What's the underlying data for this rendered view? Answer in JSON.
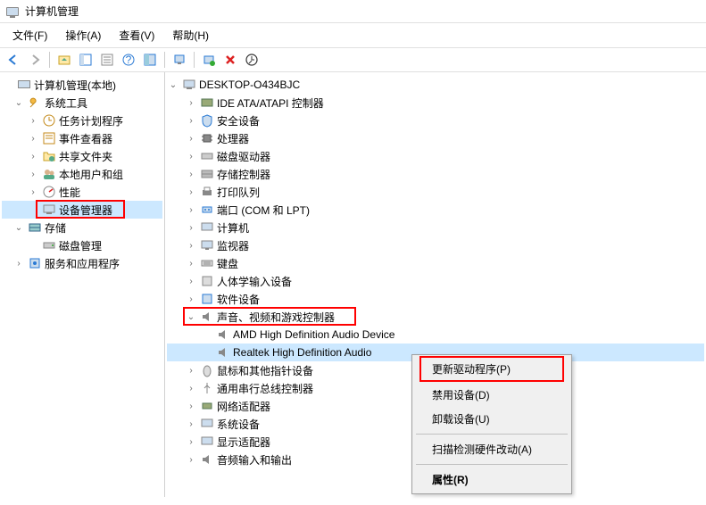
{
  "window": {
    "title": "计算机管理"
  },
  "menubar": {
    "items": [
      "文件(F)",
      "操作(A)",
      "查看(V)",
      "帮助(H)"
    ]
  },
  "left_tree": {
    "root": "计算机管理(本地)",
    "system_tools": {
      "label": "系统工具",
      "children": {
        "task_scheduler": "任务计划程序",
        "event_viewer": "事件查看器",
        "shared_folders": "共享文件夹",
        "local_users": "本地用户和组",
        "performance": "性能",
        "device_manager": "设备管理器"
      }
    },
    "storage": {
      "label": "存储",
      "disk_mgmt": "磁盘管理"
    },
    "services": "服务和应用程序"
  },
  "right_tree": {
    "root": "DESKTOP-O434BJC",
    "categories": {
      "ide": "IDE ATA/ATAPI 控制器",
      "security": "安全设备",
      "processors": "处理器",
      "disk_drives": "磁盘驱动器",
      "storage_ctrl": "存储控制器",
      "print_queues": "打印队列",
      "ports": "端口 (COM 和 LPT)",
      "computer": "计算机",
      "monitors": "监视器",
      "keyboards": "键盘",
      "hid": "人体学输入设备",
      "software": "软件设备",
      "sound": "声音、视频和游戏控制器",
      "mice": "鼠标和其他指针设备",
      "usb": "通用串行总线控制器",
      "network": "网络适配器",
      "system": "系统设备",
      "display": "显示适配器",
      "audio_io": "音频输入和输出"
    },
    "sound_children": {
      "amd": "AMD High Definition Audio Device",
      "realtek": "Realtek High Definition Audio"
    }
  },
  "context_menu": {
    "update_driver": "更新驱动程序(P)",
    "disable": "禁用设备(D)",
    "uninstall": "卸载设备(U)",
    "scan": "扫描检测硬件改动(A)",
    "properties": "属性(R)"
  }
}
